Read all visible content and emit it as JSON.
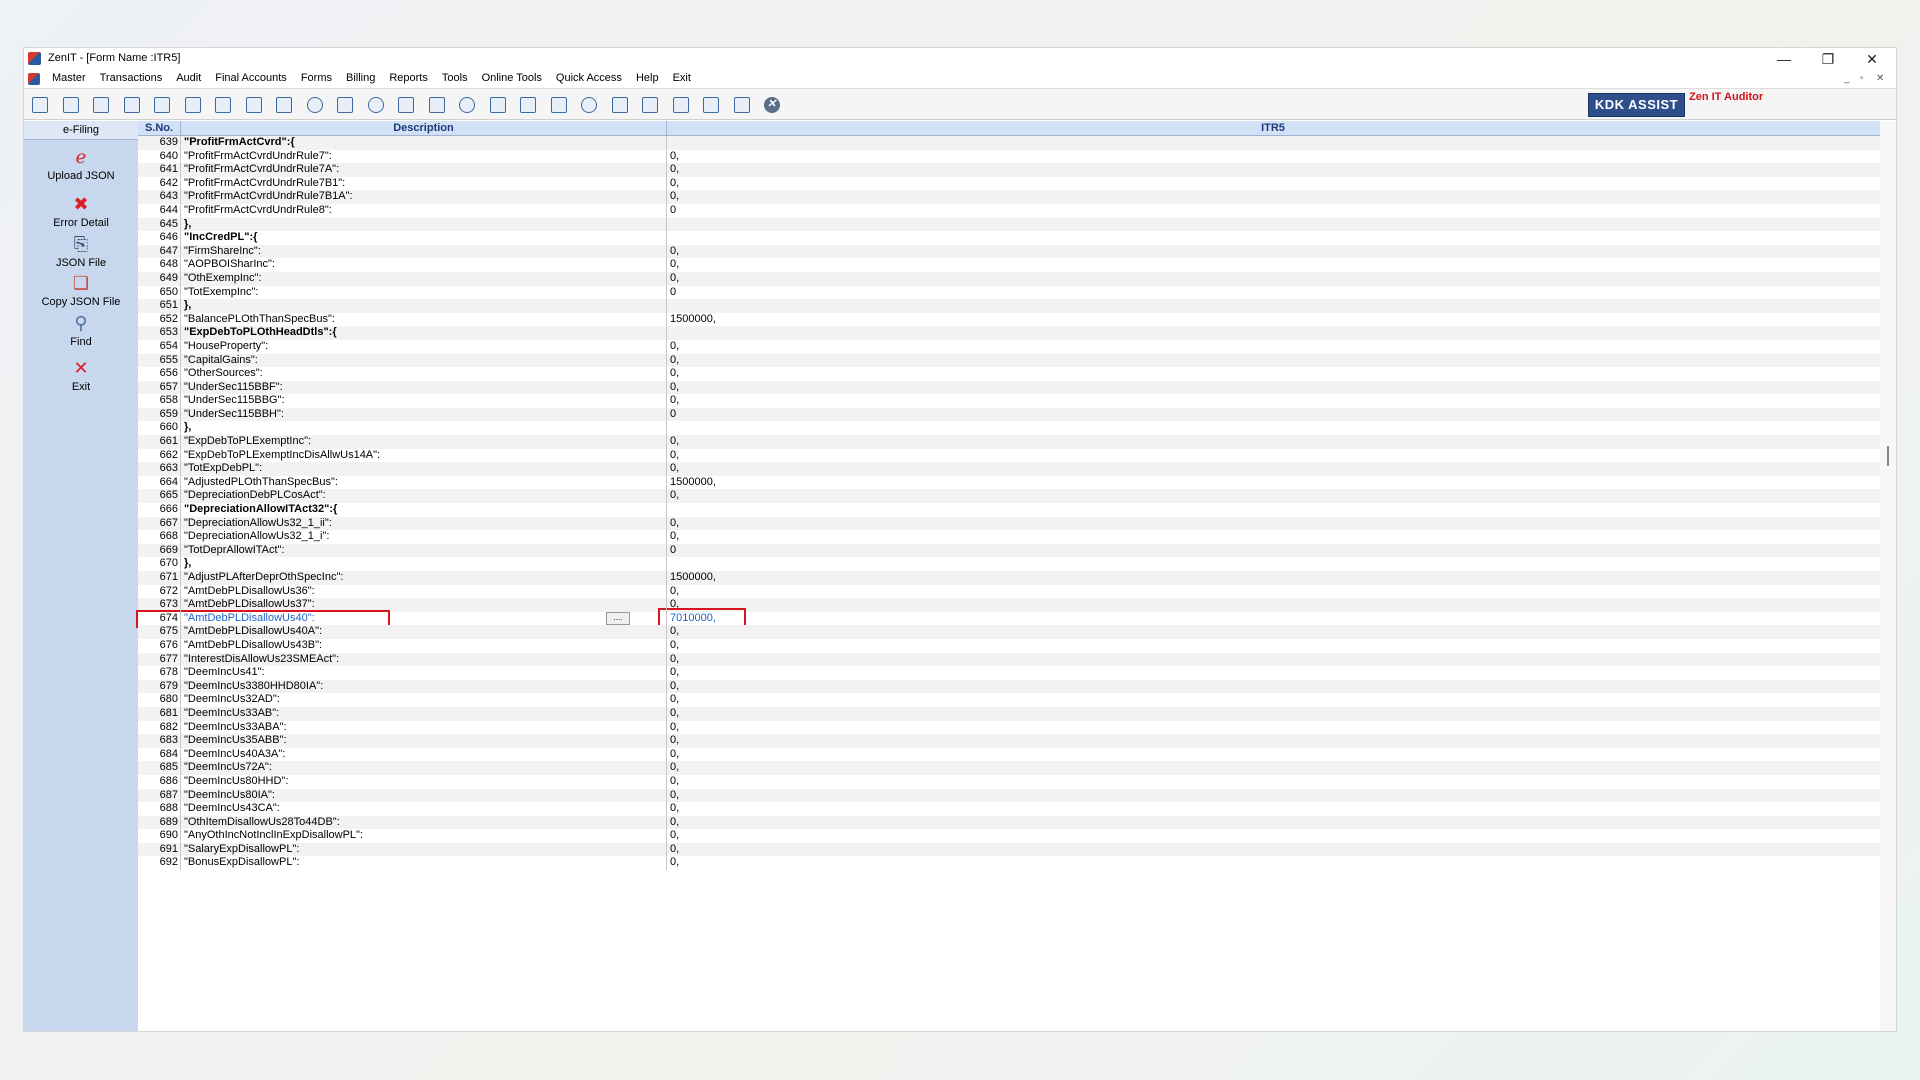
{
  "window": {
    "title": "ZenIT - [Form Name :ITR5]",
    "controls": {
      "minimize": "—",
      "restore": "❐",
      "close": "✕"
    },
    "mdi_controls": [
      "_",
      "▫",
      "✕"
    ]
  },
  "menu": [
    "Master",
    "Transactions",
    "Audit",
    "Final Accounts",
    "Forms",
    "Billing",
    "Reports",
    "Tools",
    "Online Tools",
    "Quick Access",
    "Help",
    "Exit"
  ],
  "toolbar": {
    "icons": [
      "open-icon",
      "home-icon",
      "grid-icon",
      "chart-icon",
      "gift-icon",
      "users-icon",
      "tag-icon",
      "filter-icon",
      "tax-icon",
      "record-icon",
      "calculator-icon",
      "pie-icon",
      "pay-icon",
      "book-icon",
      "info-icon",
      "table-icon",
      "export-icon",
      "calendar-icon",
      "shield-icon",
      "copy-icon",
      "bs-icon",
      "camera-icon",
      "xcd-icon",
      "report-icon",
      "close-icon"
    ],
    "brand_label": "KDK ASSIST",
    "auditor_label": "Zen IT Auditor"
  },
  "sidebar": {
    "header": "e-Filing",
    "items": [
      {
        "label": "Upload JSON",
        "icon": "upload-json-icon",
        "glyph": "ℯ"
      },
      {
        "label": "Error Detail",
        "icon": "error-x-icon",
        "glyph": "✖"
      },
      {
        "label": "JSON File",
        "icon": "json-file-icon",
        "glyph": "⎘"
      },
      {
        "label": "Copy JSON File",
        "icon": "copy-file-icon",
        "glyph": "❏"
      },
      {
        "label": "Find",
        "icon": "search-icon",
        "glyph": "⚲"
      },
      {
        "label": "Exit",
        "icon": "exit-icon",
        "glyph": "✕"
      }
    ]
  },
  "grid": {
    "headers": {
      "sno": "S.No.",
      "desc": "Description",
      "val": "ITR5"
    },
    "selected_sno": "674",
    "rows": [
      {
        "sno": "639",
        "desc": "\"ProfitFrmActCvrd\":{",
        "val": "",
        "bold": true
      },
      {
        "sno": "640",
        "desc": "\"ProfitFrmActCvrdUndrRule7\":",
        "val": "0,"
      },
      {
        "sno": "641",
        "desc": "\"ProfitFrmActCvrdUndrRule7A\":",
        "val": "0,"
      },
      {
        "sno": "642",
        "desc": "\"ProfitFrmActCvrdUndrRule7B1\":",
        "val": "0,"
      },
      {
        "sno": "643",
        "desc": "\"ProfitFrmActCvrdUndrRule7B1A\":",
        "val": "0,"
      },
      {
        "sno": "644",
        "desc": "\"ProfitFrmActCvrdUndrRule8\":",
        "val": "0"
      },
      {
        "sno": "645",
        "desc": "},",
        "val": "",
        "bold": true
      },
      {
        "sno": "646",
        "desc": "\"IncCredPL\":{",
        "val": "",
        "bold": true
      },
      {
        "sno": "647",
        "desc": "\"FirmShareInc\":",
        "val": "0,"
      },
      {
        "sno": "648",
        "desc": "\"AOPBOISharInc\":",
        "val": "0,"
      },
      {
        "sno": "649",
        "desc": "\"OthExempInc\":",
        "val": "0,"
      },
      {
        "sno": "650",
        "desc": "\"TotExempInc\":",
        "val": "0"
      },
      {
        "sno": "651",
        "desc": "},",
        "val": "",
        "bold": true
      },
      {
        "sno": "652",
        "desc": "\"BalancePLOthThanSpecBus\":",
        "val": "1500000,"
      },
      {
        "sno": "653",
        "desc": "\"ExpDebToPLOthHeadDtls\":{",
        "val": "",
        "bold": true
      },
      {
        "sno": "654",
        "desc": "\"HouseProperty\":",
        "val": "0,"
      },
      {
        "sno": "655",
        "desc": "\"CapitalGains\":",
        "val": "0,"
      },
      {
        "sno": "656",
        "desc": "\"OtherSources\":",
        "val": "0,"
      },
      {
        "sno": "657",
        "desc": "\"UnderSec115BBF\":",
        "val": "0,"
      },
      {
        "sno": "658",
        "desc": "\"UnderSec115BBG\":",
        "val": "0,"
      },
      {
        "sno": "659",
        "desc": "\"UnderSec115BBH\":",
        "val": "0"
      },
      {
        "sno": "660",
        "desc": "},",
        "val": "",
        "bold": true
      },
      {
        "sno": "661",
        "desc": "\"ExpDebToPLExemptInc\":",
        "val": "0,"
      },
      {
        "sno": "662",
        "desc": "\"ExpDebToPLExemptIncDisAllwUs14A\":",
        "val": "0,"
      },
      {
        "sno": "663",
        "desc": "\"TotExpDebPL\":",
        "val": "0,"
      },
      {
        "sno": "664",
        "desc": "\"AdjustedPLOthThanSpecBus\":",
        "val": "1500000,"
      },
      {
        "sno": "665",
        "desc": "\"DepreciationDebPLCosAct\":",
        "val": "0,"
      },
      {
        "sno": "666",
        "desc": "\"DepreciationAllowITAct32\":{",
        "val": "",
        "bold": true
      },
      {
        "sno": "667",
        "desc": "\"DepreciationAllowUs32_1_ii\":",
        "val": "0,"
      },
      {
        "sno": "668",
        "desc": "\"DepreciationAllowUs32_1_i\":",
        "val": "0,"
      },
      {
        "sno": "669",
        "desc": "\"TotDeprAllowITAct\":",
        "val": "0"
      },
      {
        "sno": "670",
        "desc": "},",
        "val": "",
        "bold": true
      },
      {
        "sno": "671",
        "desc": "\"AdjustPLAfterDeprOthSpecInc\":",
        "val": "1500000,"
      },
      {
        "sno": "672",
        "desc": "\"AmtDebPLDisallowUs36\":",
        "val": "0,"
      },
      {
        "sno": "673",
        "desc": "\"AmtDebPLDisallowUs37\":",
        "val": "0,"
      },
      {
        "sno": "674",
        "desc": "\"AmtDebPLDisallowUs40\":",
        "val": "7010000,"
      },
      {
        "sno": "675",
        "desc": "\"AmtDebPLDisallowUs40A\":",
        "val": "0,"
      },
      {
        "sno": "676",
        "desc": "\"AmtDebPLDisallowUs43B\":",
        "val": "0,"
      },
      {
        "sno": "677",
        "desc": "\"InterestDisAllowUs23SMEAct\":",
        "val": "0,"
      },
      {
        "sno": "678",
        "desc": "\"DeemIncUs41\":",
        "val": "0,"
      },
      {
        "sno": "679",
        "desc": "\"DeemIncUs3380HHD80IA\":",
        "val": "0,"
      },
      {
        "sno": "680",
        "desc": "\"DeemIncUs32AD\":",
        "val": "0,"
      },
      {
        "sno": "681",
        "desc": "\"DeemIncUs33AB\":",
        "val": "0,"
      },
      {
        "sno": "682",
        "desc": "\"DeemIncUs33ABA\":",
        "val": "0,"
      },
      {
        "sno": "683",
        "desc": "\"DeemIncUs35ABB\":",
        "val": "0,"
      },
      {
        "sno": "684",
        "desc": "\"DeemIncUs40A3A\":",
        "val": "0,"
      },
      {
        "sno": "685",
        "desc": "\"DeemIncUs72A\":",
        "val": "0,"
      },
      {
        "sno": "686",
        "desc": "\"DeemIncUs80HHD\":",
        "val": "0,"
      },
      {
        "sno": "687",
        "desc": "\"DeemIncUs80IA\":",
        "val": "0,"
      },
      {
        "sno": "688",
        "desc": "\"DeemIncUs43CA\":",
        "val": "0,"
      },
      {
        "sno": "689",
        "desc": "\"OthItemDisallowUs28To44DB\":",
        "val": "0,"
      },
      {
        "sno": "690",
        "desc": "\"AnyOthIncNotInclInExpDisallowPL\":",
        "val": "0,"
      },
      {
        "sno": "691",
        "desc": "\"SalaryExpDisallowPL\":",
        "val": "0,"
      },
      {
        "sno": "692",
        "desc": "\"BonusExpDisallowPL\":",
        "val": "0,"
      }
    ]
  },
  "colors": {
    "highlight_box": "#d9141e",
    "selected_text": "#1e64c8",
    "sidebar_bg": "#c7d7ed",
    "brand_bg": "#2f4f8a"
  }
}
